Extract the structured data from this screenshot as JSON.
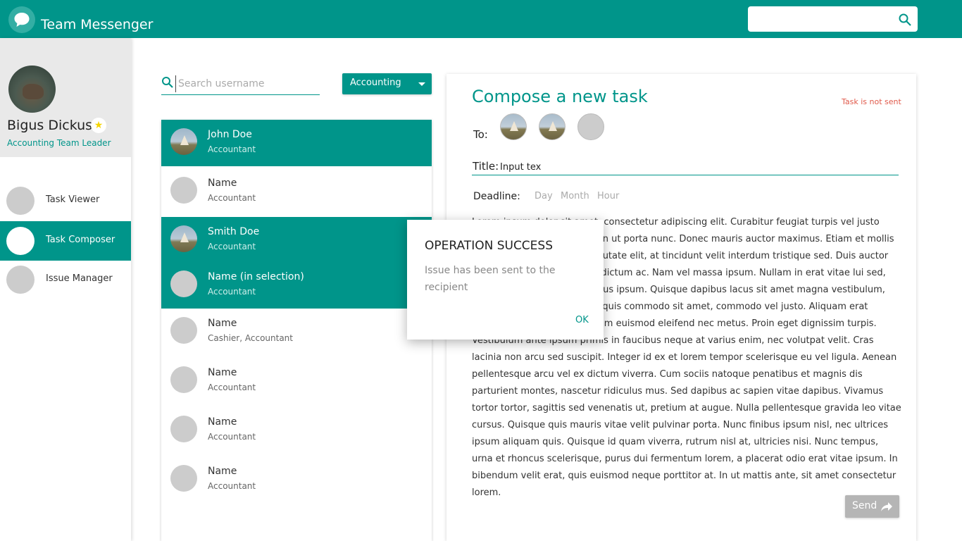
{
  "app": {
    "title": "Team Messenger"
  },
  "profile": {
    "name": "Bigus Dickus",
    "role": "Accounting Team Leader"
  },
  "nav": [
    {
      "label": "Task Viewer",
      "active": false
    },
    {
      "label": "Task Composer",
      "active": true
    },
    {
      "label": "Issue Manager",
      "active": false
    }
  ],
  "user_search": {
    "placeholder": "Search username"
  },
  "department": {
    "selected": "Accounting"
  },
  "users": [
    {
      "name": "John Doe",
      "role": "Accountant",
      "selected": true,
      "photo": true
    },
    {
      "name": "Name",
      "role": "Accountant",
      "selected": false,
      "photo": false
    },
    {
      "name": "Smith Doe",
      "role": "Accountant",
      "selected": true,
      "photo": true
    },
    {
      "name": "Name (in selection)",
      "role": "Accountant",
      "selected": true,
      "photo": false
    },
    {
      "name": "Name",
      "role": "Cashier, Accountant",
      "selected": false,
      "photo": false
    },
    {
      "name": "Name",
      "role": "Accountant",
      "selected": false,
      "photo": false
    },
    {
      "name": "Name",
      "role": "Accountant",
      "selected": false,
      "photo": false
    },
    {
      "name": "Name",
      "role": "Accountant",
      "selected": false,
      "photo": false
    }
  ],
  "compose": {
    "title": "Compose a new task",
    "status": "Task is not sent",
    "to_label": "To:",
    "title_label": "Title:",
    "title_value": "Input tex",
    "deadline_label": "Deadline:",
    "deadline_fields": [
      "Day",
      "Month",
      "Hour"
    ],
    "body": "Lorem ipsum dolor sit amet, consectetur adipiscing elit. Curabitur feugiat turpis vel justo convallis consectetur. Aenean ut porta nunc. Donec mauris auctor maximus. Etiam et mollis mauris. Fusce hendrerit vulputate elit, at tincidunt velit interdum tristique sed. Duis auctor tempor est, at facilisis risus dictum ac. Nam vel massa ipsum. Nullam in erat vitae lui sed, porttitor ex. Donec ac faucibus ipsum. Quisque dapibus lacus sit amet magna vestibulum, aliquam sapien, scelerisque quis commodo sit amet, commodo vel justo. Aliquam erat volutpat. Vestibulum dignissim euismod eleifend nec metus. Proin eget dignissim turpis. Vestibulum ante ipsum primis in faucibus neque at varius enim, nec volutpat velit. Cras lacinia non arcu sed suscipit. Integer id ex et lorem tempor scelerisque eu vel ligula. Aenean pellentesque arcu vel ex dictum viverra. Cum sociis natoque penatibus et magnis dis parturient montes, nascetur ridiculus mus. Sed dapibus ac sapien vitae dapibus. Vivamus tortor tortor, sagittis sed venenatis ut, pretium at augue. Nulla pellentesque gravida leo vitae cursus. Quisque quis mauris vitae velit pulvinar porta. Nunc finibus ipsum nisl, nec ultrices ipsum aliquam quis. Quisque id quam viverra, rutrum nisl at, ultricies nisi. Nunc tempus, urna et rhoncus scelerisque, purus dui fermentum lorem, a placerat odio erat vitae ipsum. In bibendum velit erat, quis euismod neque porttitor at. In ut mattis ante, sit amet consectetur lorem.",
    "send_label": "Send"
  },
  "dialog": {
    "title": "OPERATION SUCCESS",
    "message": "Issue has been sent to the recipient",
    "ok_label": "OK"
  },
  "colors": {
    "accent": "#00958a",
    "status_error": "#e0594a",
    "avatar_placeholder": "#cccccc"
  }
}
